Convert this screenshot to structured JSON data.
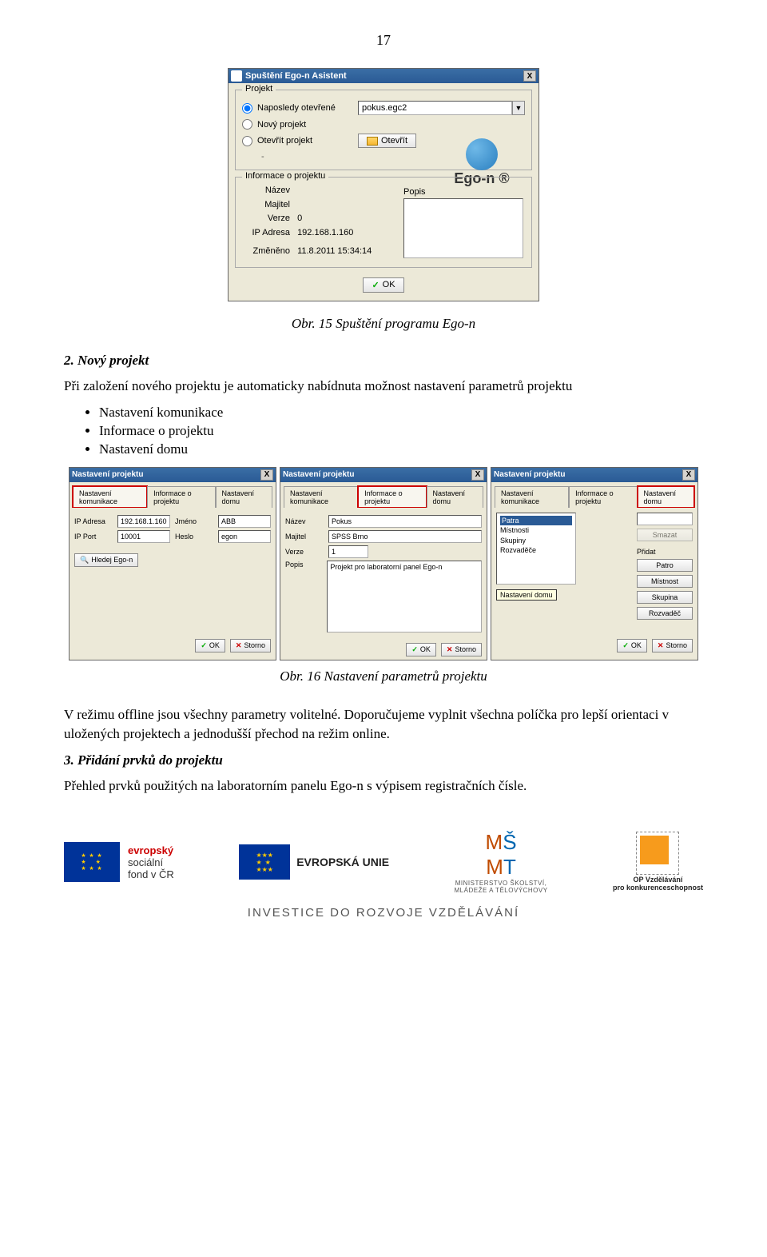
{
  "page_number": "17",
  "dialog1": {
    "title": "Spuštění Ego-n Asistent",
    "group_project": "Projekt",
    "radio_recent": "Naposledy otevřené",
    "recent_file": "pokus.egc2",
    "radio_new": "Nový projekt",
    "radio_open": "Otevřít projekt",
    "open_button": "Otevřít",
    "logo_text": "Ego-n ®",
    "group_info": "Informace o projektu",
    "lbl_name": "Název",
    "lbl_owner": "Majitel",
    "lbl_version": "Verze",
    "val_version": "0",
    "lbl_ip": "IP Adresa",
    "val_ip": "192.168.1.160",
    "lbl_changed": "Změněno",
    "val_changed": "11.8.2011 15:34:14",
    "lbl_popis": "Popis",
    "ok": "OK",
    "close_x": "X"
  },
  "caption1": "Obr. 15 Spuštění programu Ego-n",
  "section2": {
    "title": "2.  Nový projekt",
    "intro": "Při založení nového projektu je automaticky nabídnuta možnost nastavení parametrů projektu",
    "bullets": [
      "Nastavení komunikace",
      "Informace o projektu",
      "Nastavení domu"
    ]
  },
  "shots": {
    "title": "Nastavení projektu",
    "tab_comm": "Nastavení komunikace",
    "tab_info": "Informace o projektu",
    "tab_house": "Nastavení domu",
    "ip_label": "IP Adresa",
    "ip_val": "192.168.1.160",
    "port_label": "IP Port",
    "port_val": "10001",
    "name_label": "Jméno",
    "name_val": "ABB",
    "pass_label": "Heslo",
    "pass_val": "egon",
    "search_btn": "Hledej Ego-n",
    "nazev_label": "Název",
    "nazev_val": "Pokus",
    "majitel_label": "Majitel",
    "majitel_val": "SPSS Brno",
    "verze_label": "Verze",
    "verze_val": "1",
    "popis_label": "Popis",
    "popis_val": "Projekt pro laboratorní panel Ego-n",
    "tree_items": [
      "Patra",
      "Místnosti",
      "Skupiny",
      "Rozvaděče"
    ],
    "tooltip": "Nastavení domu",
    "btn_smazat": "Smazat",
    "btn_add": "Přidat",
    "btn_floor": "Patro",
    "btn_room": "Místnost",
    "btn_group": "Skupina",
    "btn_panel": "Rozvaděč",
    "ok": "OK",
    "storno": "Storno"
  },
  "caption2": "Obr. 16 Nastavení parametrů projektu",
  "para1": "V režimu offline jsou všechny parametry volitelné. Doporučujeme vyplnit všechna políčka pro lepší orientaci v uložených projektech a jednodušší  přechod na režim online.",
  "section3": {
    "title": "3.  Přidání prvků do projektu",
    "text": "Přehled prvků použitých na laboratorním panelu Ego-n  s výpisem registračních čísle."
  },
  "footer": {
    "esf_line1": "evropský",
    "esf_line2": "sociální",
    "esf_line3": "fond v ČR",
    "eu": "EVROPSKÁ UNIE",
    "msmt_line1": "MINISTERSTVO ŠKOLSTVÍ,",
    "msmt_line2": "MLÁDEŽE A TĚLOVÝCHOVY",
    "opvk_line1": "OP Vzdělávání",
    "opvk_line2": "pro konkurenceschopnost",
    "invest": "INVESTICE DO ROZVOJE VZDĚLÁVÁNÍ"
  }
}
